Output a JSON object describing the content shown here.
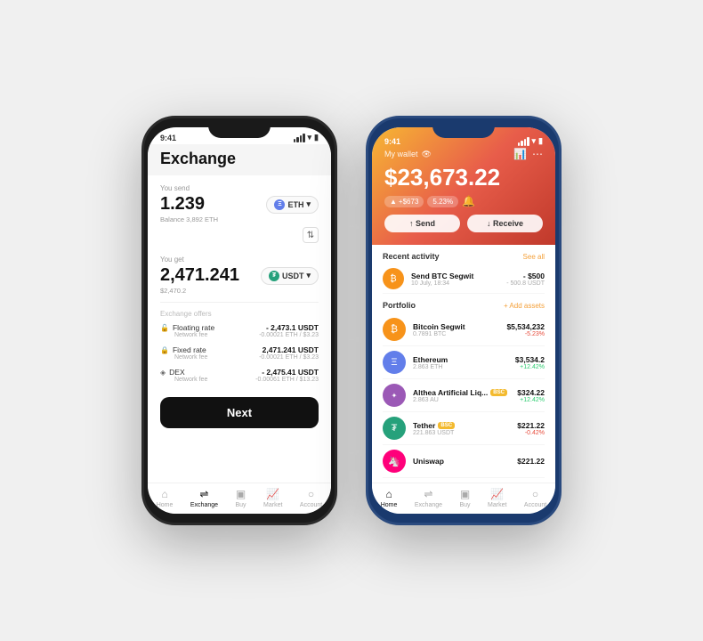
{
  "scene": {
    "bg_color": "#f0f0f0"
  },
  "left_phone": {
    "status_time": "9:41",
    "header_title": "Exchange",
    "you_send_label": "You send",
    "send_amount": "1.239",
    "send_currency": "ETH",
    "send_balance": "Balance 3,892 ETH",
    "you_get_label": "You get",
    "get_amount": "2,471.241",
    "get_currency": "USDT",
    "get_usd": "$2,470.2",
    "offers_label": "Exchange offers",
    "offer1_name": "Floating rate",
    "offer1_amount": "- 2,473.1 USDT",
    "offer1_fee_label": "Network fee",
    "offer1_fee": "-0.00021 ETH / $3.23",
    "offer2_name": "Fixed rate",
    "offer2_amount": "2,471.241 USDT",
    "offer2_fee_label": "Network fee",
    "offer2_fee": "-0.00021 ETH / $3.23",
    "offer3_name": "DEX",
    "offer3_amount": "- 2,475.41 USDT",
    "offer3_fee_label": "Network fee",
    "offer3_fee": "-0.00061 ETH / $13.23",
    "next_btn": "Next",
    "nav": {
      "home": "Home",
      "exchange": "Exchange",
      "buy": "Buy",
      "market": "Market",
      "account": "Account"
    }
  },
  "right_phone": {
    "status_time": "9:41",
    "wallet_title": "My wallet",
    "balance": "$23,673.22",
    "change_amount": "+$673",
    "change_percent": "5.23%",
    "send_label": "↑ Send",
    "receive_label": "↓ Receive",
    "recent_activity_label": "Recent activity",
    "see_all": "See all",
    "activity": {
      "name": "Send BTC Segwit",
      "amount": "- $500",
      "date": "10 July, 18:34",
      "secondary": "- 500.8 USDT"
    },
    "portfolio_label": "Portfolio",
    "add_assets": "+ Add assets",
    "coins": [
      {
        "name": "Bitcoin Segwit",
        "badge": "",
        "amount": "0.7891 BTC",
        "value": "$5,534,232",
        "change": "-5.23%",
        "direction": "negative",
        "icon": "₿"
      },
      {
        "name": "Ethereum",
        "badge": "",
        "amount": "2.863 ETH",
        "value": "$3,534.2",
        "change": "+12.42%",
        "direction": "positive",
        "icon": "Ξ"
      },
      {
        "name": "Althea Artificial Liq...",
        "badge": "BSC",
        "amount": "2.863 AU",
        "value": "$324.22",
        "change": "+12.42%",
        "direction": "positive",
        "icon": "A"
      },
      {
        "name": "Tether",
        "badge": "BSC",
        "amount": "221.863 USDT",
        "value": "$221.22",
        "change": "-0.42%",
        "direction": "negative",
        "icon": "₮"
      },
      {
        "name": "Uniswap",
        "badge": "",
        "amount": "",
        "value": "$221.22",
        "change": "",
        "direction": "",
        "icon": "🦄"
      }
    ],
    "nav": {
      "home": "Home",
      "exchange": "Exchange",
      "buy": "Buy",
      "market": "Market",
      "account": "Account"
    }
  }
}
